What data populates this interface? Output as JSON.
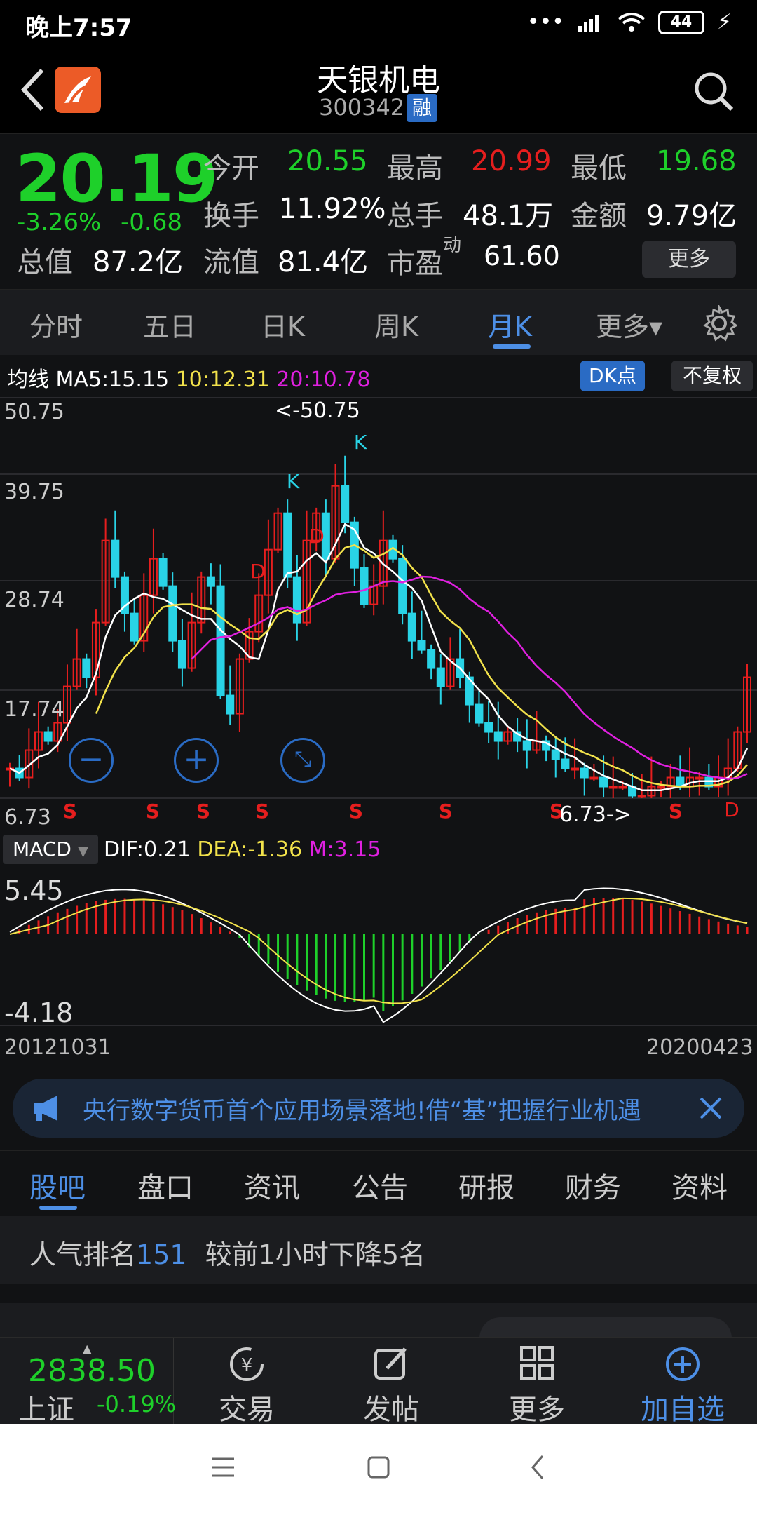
{
  "status": {
    "time": "晚上7:57",
    "battery": "44"
  },
  "header": {
    "title": "天银机电",
    "code": "300342",
    "margin_badge": "融",
    "icons": [
      "back-icon",
      "app-logo",
      "search-icon"
    ]
  },
  "quote": {
    "price": "20.19",
    "change_pct": "-3.26%",
    "change": "-0.68",
    "open_label": "今开",
    "open": "20.55",
    "high_label": "最高",
    "high": "20.99",
    "low_label": "最低",
    "low": "19.68",
    "turnover_label": "换手",
    "turnover": "11.92%",
    "volume_label": "总手",
    "volume": "48.1万",
    "amount_label": "金额",
    "amount": "9.79亿",
    "mcap_label": "总值",
    "mcap": "87.2亿",
    "float_label": "流值",
    "float": "81.4亿",
    "pe_label": "市盈",
    "pe_sup": "动",
    "pe": "61.60",
    "more_label": "更多"
  },
  "period_tabs": [
    "分时",
    "五日",
    "日K",
    "周K",
    "月K",
    "更多▾"
  ],
  "active_period": "月K",
  "chart": {
    "ma_label": "均线",
    "ma5": "MA5:15.15",
    "ma10": "10:12.31",
    "ma20": "20:10.78",
    "dk_label": "DK点",
    "fq_label": "不复权",
    "y_labels": [
      "50.75",
      "39.75",
      "28.74",
      "17.74",
      "6.73"
    ],
    "max_marker": "<-50.75",
    "min_marker": "6.73->",
    "macd_select": "MACD",
    "dif": "DIF:0.21",
    "dea": "DEA:-1.36",
    "m": "M:3.15",
    "macd_high": "5.45",
    "macd_low": "-4.18",
    "start_date": "20121031",
    "end_date": "20200423",
    "signals": {
      "s": "S",
      "k": "K",
      "d": "D"
    },
    "colors": {
      "up": "#e61e1e",
      "down": "#29d3e6",
      "ma5": "#ffffff",
      "ma10": "#f2e24b",
      "ma20": "#e020e0",
      "dea": "#f2e24b"
    }
  },
  "chart_data": {
    "type": "candlestick",
    "frequency": "monthly",
    "x_range": [
      "20121031",
      "20200423"
    ],
    "ylim": [
      6.73,
      50.75
    ],
    "period_high": 50.75,
    "period_low": 6.73,
    "last_close": 20.19,
    "ma": {
      "MA5": 15.15,
      "MA10": 12.31,
      "MA20": 10.78
    },
    "macd": {
      "DIF": 0.21,
      "DEA": -1.36,
      "M": 3.15,
      "ylim": [
        -4.18,
        5.45
      ]
    }
  },
  "banner": {
    "text": "央行数字货币首个应用场景落地!借“基”把握行业机遇"
  },
  "info_tabs": [
    "股吧",
    "盘口",
    "资讯",
    "公告",
    "研报",
    "财务",
    "资料"
  ],
  "rank": {
    "prefix": "人气排名",
    "value": "151",
    "suffix": "较前1小时下降5名"
  },
  "bottom": {
    "index_value": "2838.50",
    "index_name": "上证",
    "index_change": "-0.19%",
    "trade": "交易",
    "post": "发帖",
    "more": "更多",
    "add": "加自选"
  }
}
